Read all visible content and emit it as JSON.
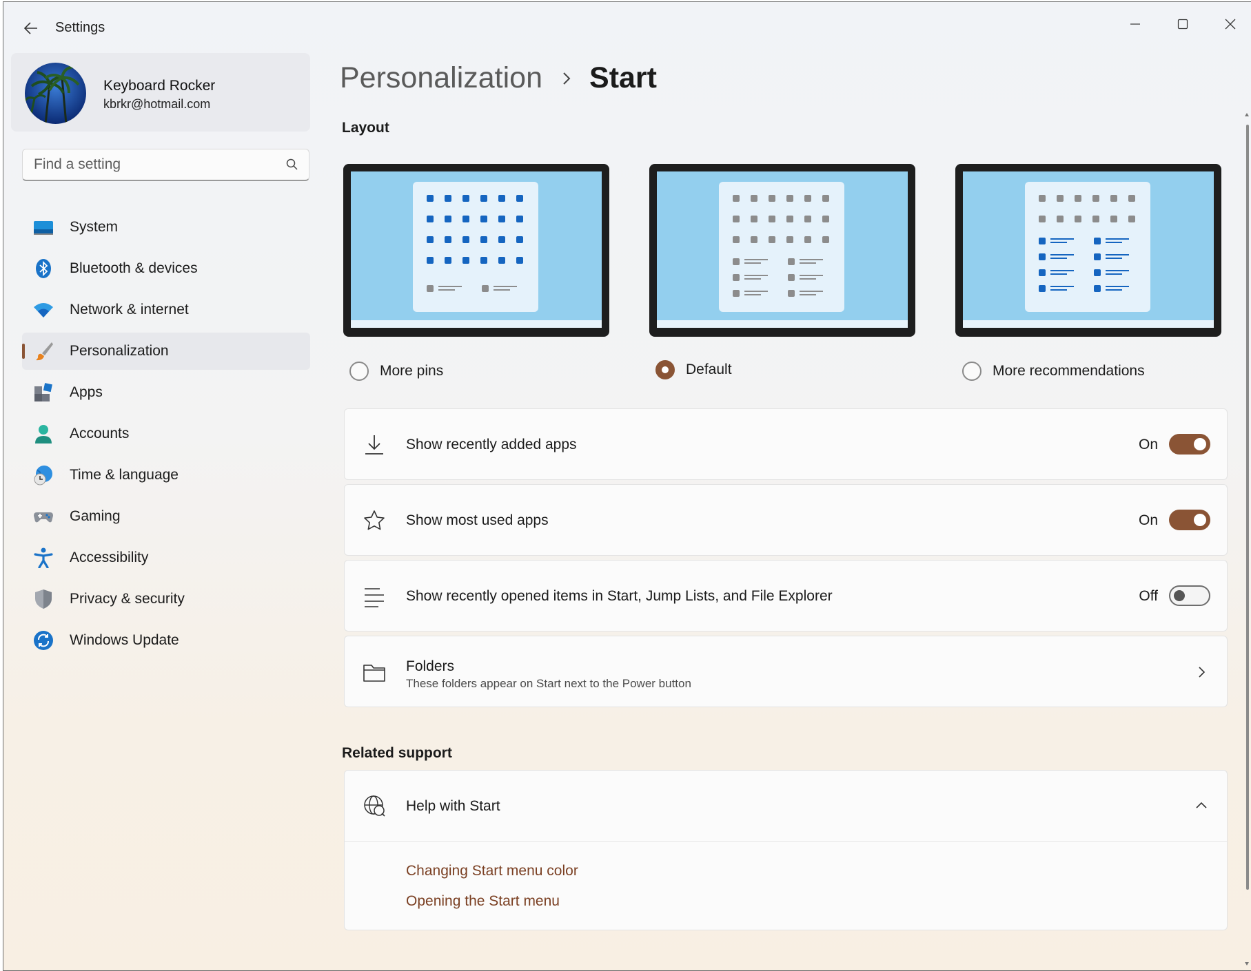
{
  "window": {
    "title": "Settings"
  },
  "profile": {
    "name": "Keyboard Rocker",
    "email": "kbrkr@hotmail.com"
  },
  "search": {
    "placeholder": "Find a setting"
  },
  "sidebar": {
    "items": [
      {
        "label": "System",
        "icon": "system-icon"
      },
      {
        "label": "Bluetooth & devices",
        "icon": "bluetooth-icon"
      },
      {
        "label": "Network & internet",
        "icon": "wifi-icon"
      },
      {
        "label": "Personalization",
        "icon": "brush-icon",
        "active": true
      },
      {
        "label": "Apps",
        "icon": "apps-icon"
      },
      {
        "label": "Accounts",
        "icon": "person-icon"
      },
      {
        "label": "Time & language",
        "icon": "globe-clock-icon"
      },
      {
        "label": "Gaming",
        "icon": "gamepad-icon"
      },
      {
        "label": "Accessibility",
        "icon": "accessibility-icon"
      },
      {
        "label": "Privacy & security",
        "icon": "shield-icon"
      },
      {
        "label": "Windows Update",
        "icon": "update-icon"
      }
    ]
  },
  "breadcrumb": {
    "parent": "Personalization",
    "current": "Start"
  },
  "layout": {
    "heading": "Layout",
    "options": [
      {
        "label": "More pins",
        "selected": false
      },
      {
        "label": "Default",
        "selected": true
      },
      {
        "label": "More recommendations",
        "selected": false
      }
    ]
  },
  "settings": [
    {
      "label": "Show recently added apps",
      "state": "On",
      "on": true,
      "icon": "download-icon"
    },
    {
      "label": "Show most used apps",
      "state": "On",
      "on": true,
      "icon": "star-icon"
    },
    {
      "label": "Show recently opened items in Start, Jump Lists, and File Explorer",
      "state": "Off",
      "on": false,
      "icon": "list-icon"
    }
  ],
  "folders": {
    "title": "Folders",
    "subtitle": "These folders appear on Start next to the Power button",
    "icon": "folder-icon"
  },
  "related": {
    "heading": "Related support",
    "help_title": "Help with Start",
    "links": [
      "Changing Start menu color",
      "Opening the Start menu"
    ]
  },
  "colors": {
    "accent": "#8a5435",
    "link": "#7a3f22",
    "preview_sky": "#93cfee",
    "preview_blue": "#1565c0",
    "preview_gray": "#8c8c8c"
  }
}
